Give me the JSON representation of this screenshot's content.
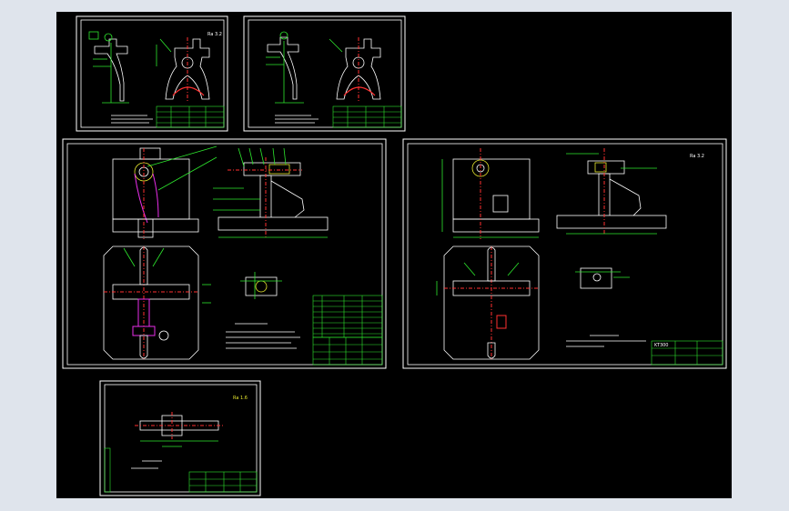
{
  "viewer": {
    "background": "#000000",
    "frame": "#dfe4ec"
  },
  "colors": {
    "outline": "#ffffff",
    "dimension": "#2ee82e",
    "center_line": "#ff3030",
    "workpiece": "#e82ee8",
    "annotation": "#e8e82e"
  },
  "sheets": [
    {
      "id": "sheet-1",
      "roughness_mark": "Ra 3.2"
    },
    {
      "id": "sheet-2"
    },
    {
      "id": "sheet-3"
    },
    {
      "id": "sheet-4",
      "title_block_code": "KT300",
      "roughness_mark": "Ra 3.2"
    },
    {
      "id": "sheet-5",
      "roughness_mark": "Ra 1.6"
    }
  ]
}
